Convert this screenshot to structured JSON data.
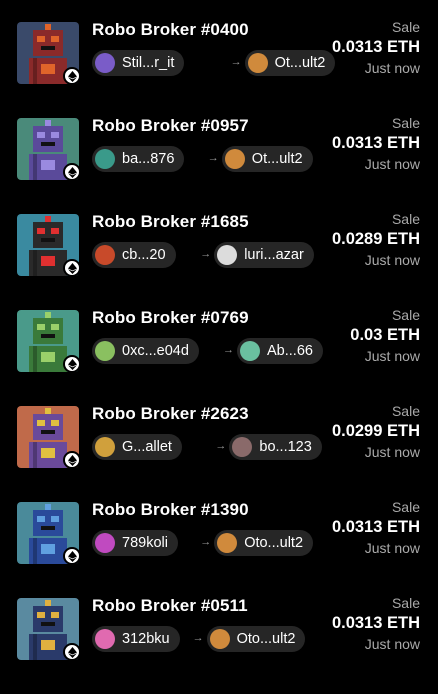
{
  "activity": [
    {
      "title": "Robo Broker #0400",
      "from": "Stil...r_it",
      "to": "Ot...ult2",
      "type": "Sale",
      "price": "0.0313 ETH",
      "time": "Just now",
      "bg": "#3a4a6a",
      "robot": "#8a2a2a",
      "accent": "#e0642a",
      "from_color": "#7a5cc8",
      "to_color": "#d08a3c"
    },
    {
      "title": "Robo Broker #0957",
      "from": "ba...876",
      "to": "Ot...ult2",
      "type": "Sale",
      "price": "0.0313 ETH",
      "time": "Just now",
      "bg": "#4a8a7a",
      "robot": "#5a4a9a",
      "accent": "#9a8ae0",
      "from_color": "#3a9a8a",
      "to_color": "#d08a3c"
    },
    {
      "title": "Robo Broker #1685",
      "from": "cb...20",
      "to": "luri...azar",
      "type": "Sale",
      "price": "0.0289 ETH",
      "time": "Just now",
      "bg": "#3a8aa0",
      "robot": "#2a2a2a",
      "accent": "#e03030",
      "from_color": "#c84a2a",
      "to_color": "#dcdcdc"
    },
    {
      "title": "Robo Broker #0769",
      "from": "0xc...e04d",
      "to": "Ab...66",
      "type": "Sale",
      "price": "0.03 ETH",
      "time": "Just now",
      "bg": "#4a9a8a",
      "robot": "#3a7a3a",
      "accent": "#9ad06a",
      "from_color": "#8ac060",
      "to_color": "#6ac0a0"
    },
    {
      "title": "Robo Broker #2623",
      "from": "G...allet",
      "to": "bo...123",
      "type": "Sale",
      "price": "0.0299 ETH",
      "time": "Just now",
      "bg": "#c06a4a",
      "robot": "#6a4a9a",
      "accent": "#e0c040",
      "from_color": "#d0a03c",
      "to_color": "#8a6a6a"
    },
    {
      "title": "Robo Broker #1390",
      "from": "789koli",
      "to": "Oto...ult2",
      "type": "Sale",
      "price": "0.0313 ETH",
      "time": "Just now",
      "bg": "#4a8a9a",
      "robot": "#2a4a9a",
      "accent": "#60a0e0",
      "from_color": "#c04ac0",
      "to_color": "#d08a3c"
    },
    {
      "title": "Robo Broker #0511",
      "from": "312bku",
      "to": "Oto...ult2",
      "type": "Sale",
      "price": "0.0313 ETH",
      "time": "Just now",
      "bg": "#5a8aa0",
      "robot": "#2a3a6a",
      "accent": "#e0b040",
      "from_color": "#e06ab0",
      "to_color": "#d08a3c"
    }
  ],
  "icons": {
    "chain": "ethereum-icon",
    "arrow": "→"
  }
}
